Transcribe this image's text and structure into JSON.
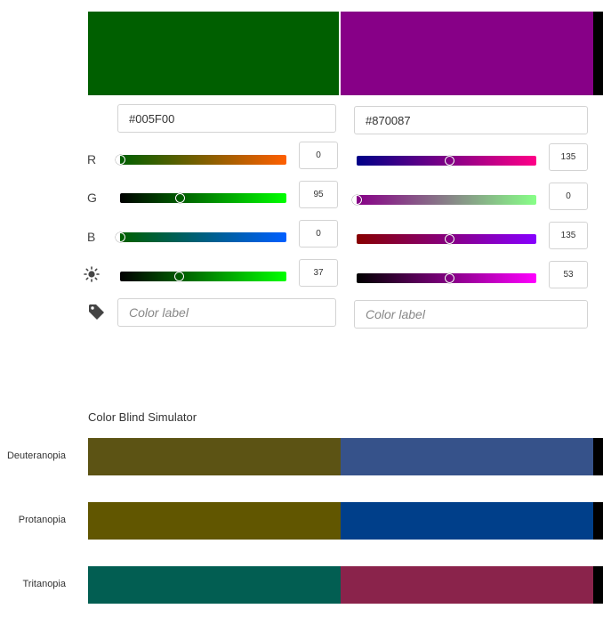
{
  "left": {
    "hex": "#005F00",
    "color": "#005F00",
    "label_placeholder": "Color label",
    "channels": [
      {
        "name": "R",
        "value": "0"
      },
      {
        "name": "G",
        "value": "95"
      },
      {
        "name": "B",
        "value": "0"
      },
      {
        "name": "brightness-icon",
        "value": "37"
      }
    ]
  },
  "right": {
    "hex": "#870087",
    "color": "#870087",
    "label_placeholder": "Color label",
    "channels": [
      {
        "name": "R",
        "value": "135"
      },
      {
        "name": "G",
        "value": "0"
      },
      {
        "name": "B",
        "value": "135"
      },
      {
        "name": "brightness-icon",
        "value": "53"
      }
    ]
  },
  "row_labels": [
    "R",
    "G",
    "B"
  ],
  "icons": {
    "brightness": "sun-icon",
    "label": "tag-icon"
  },
  "simulator": {
    "title": "Color Blind Simulator",
    "rows": [
      {
        "label": "Deuteranopia",
        "left_color": "#5C5314",
        "right_color": "#36528A"
      },
      {
        "label": "Protanopia",
        "left_color": "#615600",
        "right_color": "#003F8A"
      },
      {
        "label": "Tritanopia",
        "left_color": "#025E52",
        "right_color": "#8A234B"
      }
    ]
  }
}
